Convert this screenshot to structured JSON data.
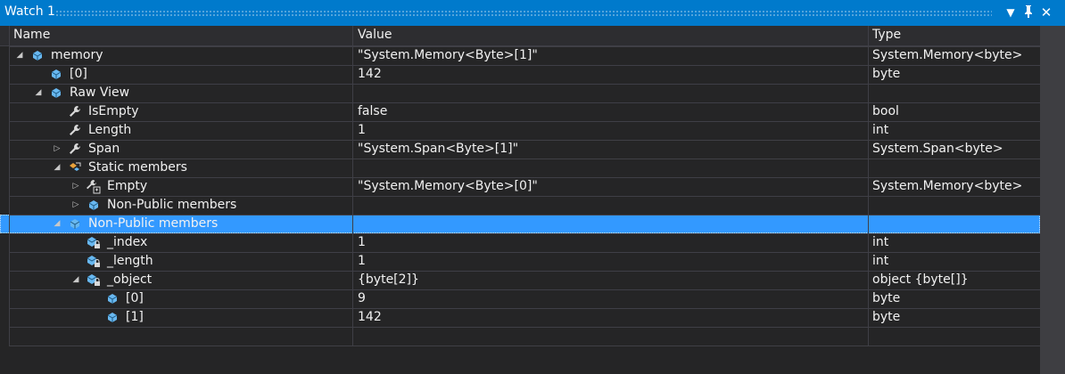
{
  "window": {
    "title": "Watch 1"
  },
  "colors": {
    "accent": "#007acc",
    "selection": "#3399ff",
    "background": "#252526"
  },
  "columns": {
    "name": "Name",
    "value": "Value",
    "type": "Type"
  },
  "rows": [
    {
      "name": "memory",
      "value": "\"System.Memory<Byte>[1]\"",
      "type": "System.Memory<byte>",
      "expander": "expanded",
      "icon": "field-icon",
      "level": 0
    },
    {
      "name": "[0]",
      "value": "142",
      "type": "byte",
      "expander": "none",
      "icon": "field-icon",
      "level": 1
    },
    {
      "name": "Raw View",
      "value": "",
      "type": "",
      "expander": "expanded",
      "icon": "field-icon",
      "level": 1
    },
    {
      "name": "IsEmpty",
      "value": "false",
      "type": "bool",
      "expander": "none",
      "icon": "property-wrench-icon",
      "level": 2
    },
    {
      "name": "Length",
      "value": "1",
      "type": "int",
      "expander": "none",
      "icon": "property-wrench-icon",
      "level": 2
    },
    {
      "name": "Span",
      "value": "\"System.Span<Byte>[1]\"",
      "type": "System.Span<byte>",
      "expander": "collapsed",
      "icon": "property-wrench-icon",
      "level": 2
    },
    {
      "name": "Static members",
      "value": "",
      "type": "",
      "expander": "expanded",
      "icon": "static-members-icon",
      "level": 2
    },
    {
      "name": "Empty",
      "value": "\"System.Memory<Byte>[0]\"",
      "type": "System.Memory<byte>",
      "expander": "collapsed",
      "icon": "static-property-icon",
      "level": 3
    },
    {
      "name": "Non-Public members",
      "value": "",
      "type": "",
      "expander": "collapsed",
      "icon": "field-icon",
      "level": 3
    },
    {
      "name": "Non-Public members",
      "value": "",
      "type": "",
      "expander": "expanded",
      "icon": "field-icon",
      "level": 2,
      "selected": true
    },
    {
      "name": "_index",
      "value": "1",
      "type": "int",
      "expander": "none",
      "icon": "private-field-icon",
      "level": 3
    },
    {
      "name": "_length",
      "value": "1",
      "type": "int",
      "expander": "none",
      "icon": "private-field-icon",
      "level": 3
    },
    {
      "name": "_object",
      "value": "{byte[2]}",
      "type": "object {byte[]}",
      "expander": "expanded",
      "icon": "private-field-icon",
      "level": 3
    },
    {
      "name": "[0]",
      "value": "9",
      "type": "byte",
      "expander": "none",
      "icon": "field-icon",
      "level": 4
    },
    {
      "name": "[1]",
      "value": "142",
      "type": "byte",
      "expander": "none",
      "icon": "field-icon",
      "level": 4
    }
  ]
}
